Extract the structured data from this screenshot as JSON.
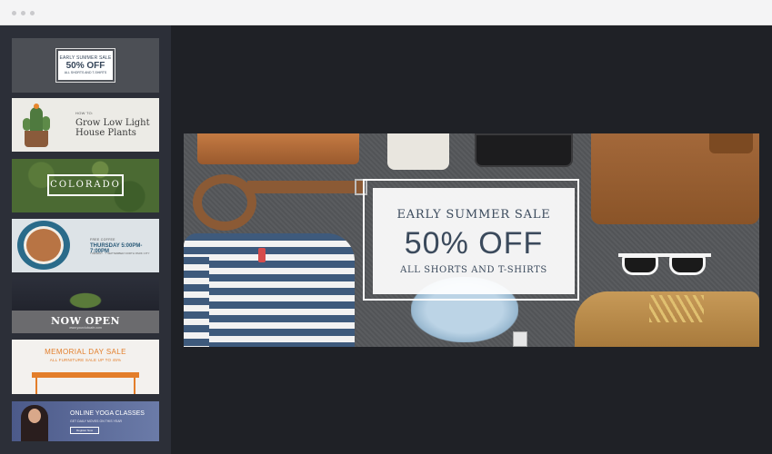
{
  "window": {
    "controls": [
      "close",
      "minimize",
      "maximize"
    ]
  },
  "templates": [
    {
      "id": "summer-sale",
      "line1": "EARLY SUMMER SALE",
      "line2": "50% OFF",
      "line3": "ALL SHORTS AND T-SHIRTS"
    },
    {
      "id": "house-plants",
      "label": "HOW TO:",
      "title_line1": "Grow Low Light",
      "title_line2": "House Plants"
    },
    {
      "id": "colorado",
      "title": "COLORADO"
    },
    {
      "id": "coffee",
      "label": "FREE COFFEE",
      "time": "THURSDAY 5:00PM-7:00PM",
      "date": "TUESDAY · 7 SEPTEMBER NORTH PARK CITY"
    },
    {
      "id": "now-open",
      "title": "NOW OPEN",
      "url": "www.yourclubcafe.com"
    },
    {
      "id": "memorial-day",
      "title": "MEMORIAL DAY SALE",
      "subtitle": "ALL FURNITURE SALE UP TO 45%"
    },
    {
      "id": "yoga",
      "title": "ONLINE YOGA CLASSES",
      "subtitle": "GET DAILY MOVES ON THIS YEAR",
      "button": "Register Now"
    }
  ],
  "banner": {
    "headline": "EARLY SUMMER SALE",
    "offer": "50% OFF",
    "subline": "ALL SHORTS AND T-SHIRTS"
  },
  "colors": {
    "background": "#1f2126",
    "sidebar": "#2c2f38",
    "titlebar": "#f4f4f5",
    "promo_text": "#3b4a5c",
    "memorial_orange": "#e37e2a"
  }
}
